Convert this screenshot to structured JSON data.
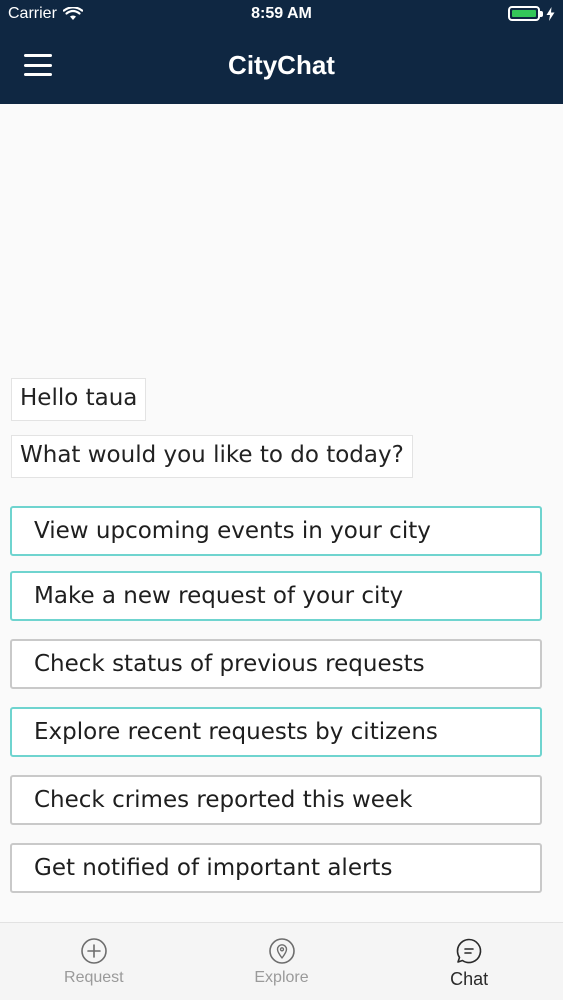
{
  "status_bar": {
    "carrier": "Carrier",
    "time": "8:59 AM",
    "battery_color": "#34c759"
  },
  "header": {
    "title": "CityChat",
    "menu_icon": "hamburger-menu-icon",
    "background": "#0f2742"
  },
  "chat": {
    "messages": [
      "Hello taua",
      "What would you like to do today?"
    ],
    "options": [
      {
        "label": "View upcoming events in your city",
        "highlighted": true
      },
      {
        "label": "Make a new request of your city",
        "highlighted": true
      },
      {
        "label": "Check status of previous requests",
        "highlighted": false
      },
      {
        "label": "Explore recent requests by citizens",
        "highlighted": true
      },
      {
        "label": "Check crimes reported this week",
        "highlighted": false
      },
      {
        "label": "Get notified of important alerts",
        "highlighted": false
      }
    ],
    "highlight_color": "#6fd4cf"
  },
  "tabbar": {
    "tabs": [
      {
        "label": "Request",
        "icon": "plus-circle-icon",
        "active": false
      },
      {
        "label": "Explore",
        "icon": "location-pin-icon",
        "active": false
      },
      {
        "label": "Chat",
        "icon": "chat-bubble-icon",
        "active": true
      }
    ]
  }
}
